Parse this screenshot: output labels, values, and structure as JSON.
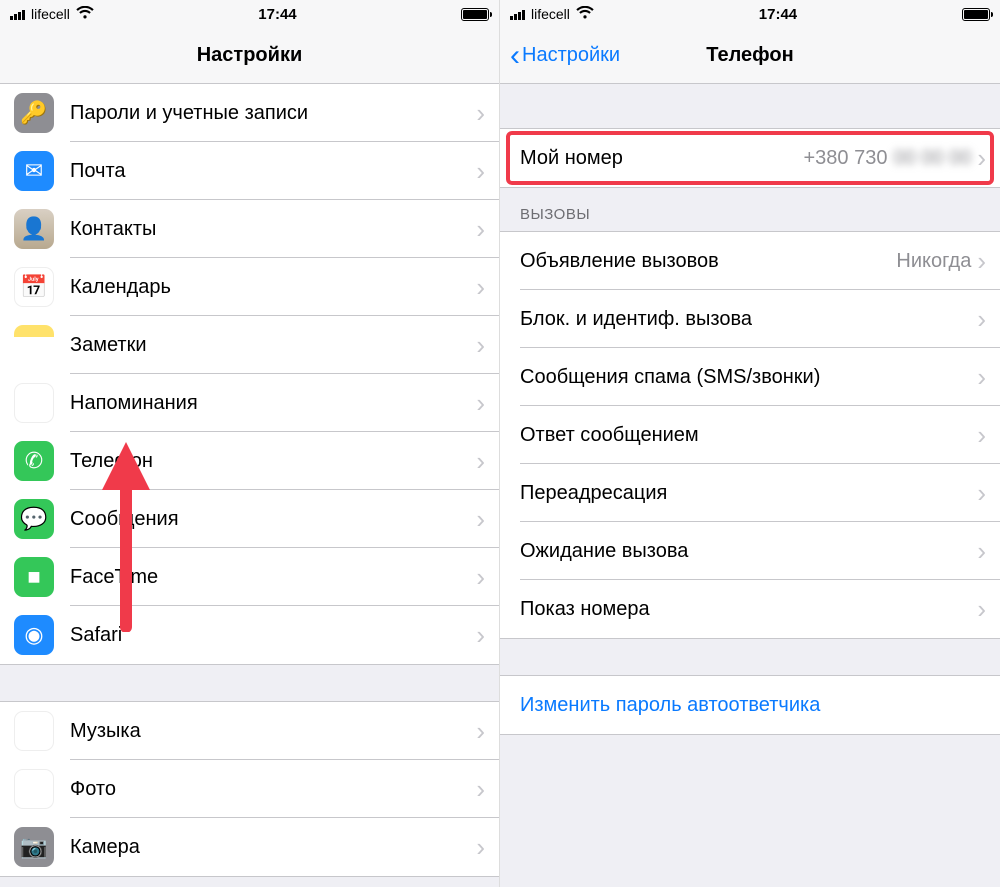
{
  "status": {
    "carrier": "lifecell",
    "time": "17:44"
  },
  "left": {
    "title": "Настройки",
    "items": [
      {
        "label": "Пароли и учетные записи",
        "icon": "key-icon",
        "cls": "ic-key",
        "glyph": "🔑"
      },
      {
        "label": "Почта",
        "icon": "mail-icon",
        "cls": "ic-mail",
        "glyph": "✉"
      },
      {
        "label": "Контакты",
        "icon": "contacts-icon",
        "cls": "ic-contacts",
        "glyph": "👤"
      },
      {
        "label": "Календарь",
        "icon": "calendar-icon",
        "cls": "ic-calendar",
        "glyph": "📅"
      },
      {
        "label": "Заметки",
        "icon": "notes-icon",
        "cls": "ic-notes",
        "glyph": ""
      },
      {
        "label": "Напоминания",
        "icon": "reminders-icon",
        "cls": "ic-remind",
        "glyph": "☰"
      },
      {
        "label": "Телефон",
        "icon": "phone-icon",
        "cls": "ic-phone",
        "glyph": "✆"
      },
      {
        "label": "Сообщения",
        "icon": "messages-icon",
        "cls": "ic-msg",
        "glyph": "💬"
      },
      {
        "label": "FaceTime",
        "icon": "facetime-icon",
        "cls": "ic-facetime",
        "glyph": "■"
      },
      {
        "label": "Safari",
        "icon": "safari-icon",
        "cls": "ic-safari",
        "glyph": "◉"
      }
    ],
    "items2": [
      {
        "label": "Музыка",
        "icon": "music-icon",
        "cls": "ic-music",
        "glyph": "♪"
      },
      {
        "label": "Фото",
        "icon": "photos-icon",
        "cls": "ic-photos",
        "glyph": "✿"
      },
      {
        "label": "Камера",
        "icon": "camera-icon",
        "cls": "ic-camera",
        "glyph": "📷"
      }
    ]
  },
  "right": {
    "back": "Настройки",
    "title": "Телефон",
    "myNumber": {
      "label": "Мой номер",
      "value": "+380 730",
      "blurred": "00 00 00"
    },
    "callsHeader": "ВЫЗОВЫ",
    "calls": [
      {
        "label": "Объявление вызовов",
        "value": "Никогда"
      },
      {
        "label": "Блок. и идентиф. вызова"
      },
      {
        "label": "Сообщения спама (SMS/звонки)"
      },
      {
        "label": "Ответ сообщением"
      },
      {
        "label": "Переадресация"
      },
      {
        "label": "Ожидание вызова"
      },
      {
        "label": "Показ номера"
      }
    ],
    "voicemail": {
      "label": "Изменить пароль автоответчика"
    }
  }
}
